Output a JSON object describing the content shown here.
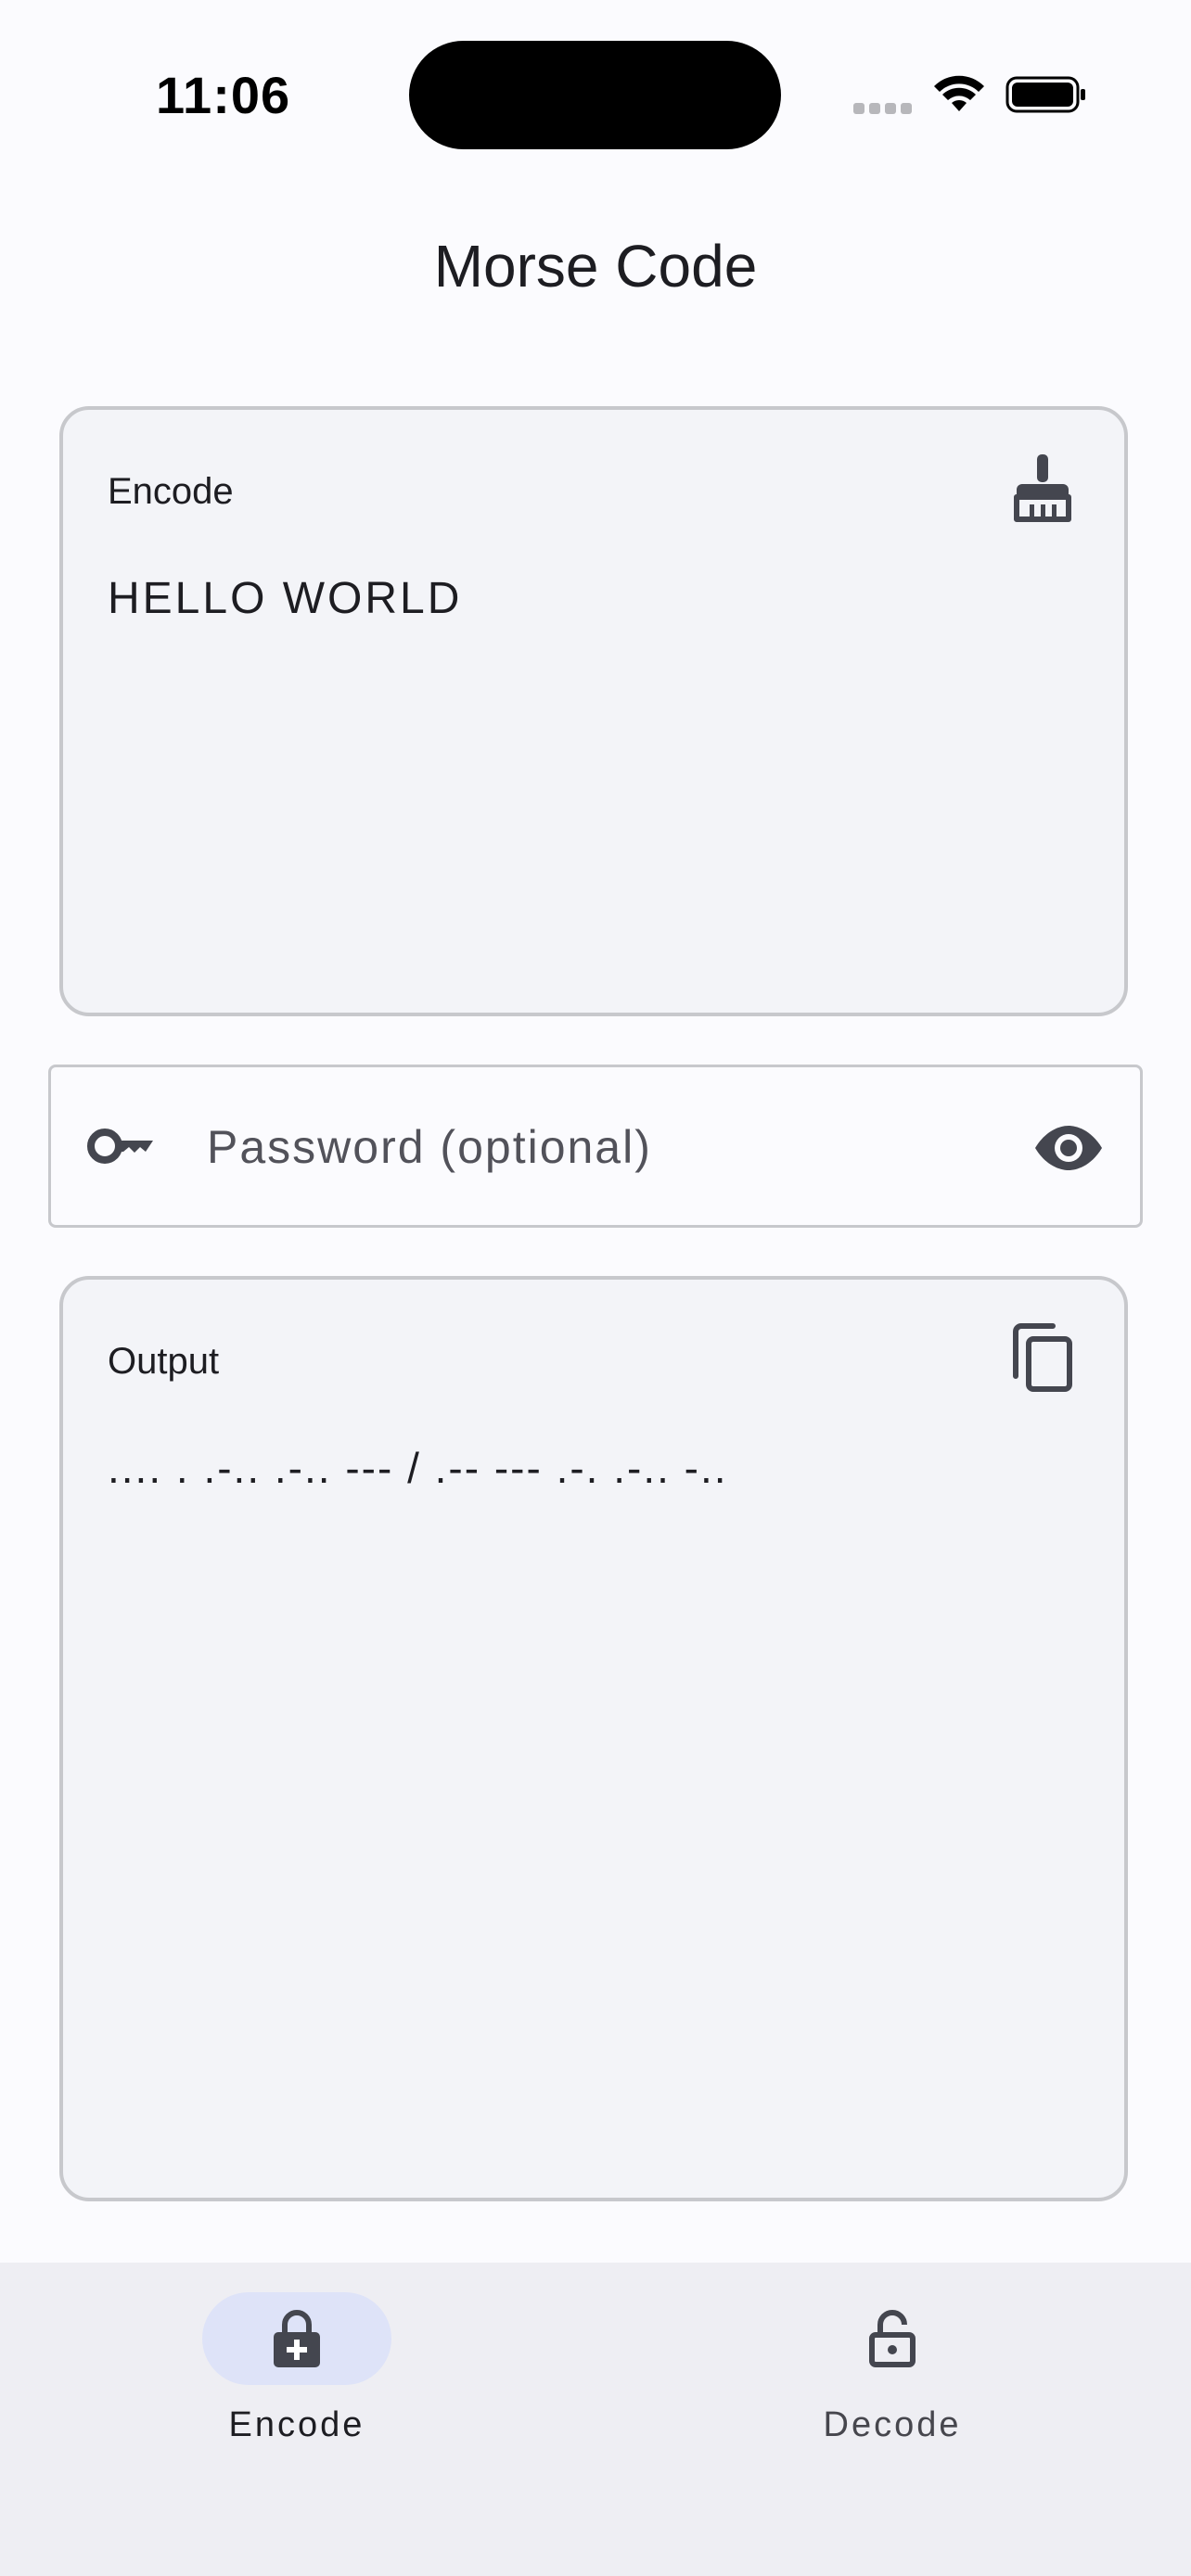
{
  "status_bar": {
    "time": "11:06"
  },
  "header": {
    "title": "Morse Code"
  },
  "encode_card": {
    "label": "Encode",
    "value": "HELLO WORLD",
    "action_icon": "cleaning-brush-icon"
  },
  "password": {
    "placeholder": "Password (optional)",
    "value": "",
    "leading_icon": "key-icon",
    "trailing_icon": "eye-icon"
  },
  "output_card": {
    "label": "Output",
    "value": ".... . .-.. .-.. --- / .-- --- .-. .-.. -..",
    "action_icon": "copy-icon"
  },
  "bottom_nav": {
    "items": [
      {
        "label": "Encode",
        "icon": "lock-plus-icon",
        "selected": true
      },
      {
        "label": "Decode",
        "icon": "lock-open-icon",
        "selected": false
      }
    ]
  },
  "colors": {
    "background": "#fbfbfe",
    "card_background": "#f3f4f8",
    "card_border": "#c7c8cc",
    "icon": "#44464f",
    "nav_background": "#eeeef3",
    "nav_indicator": "#dee3f8",
    "text": "#1d1d22"
  }
}
